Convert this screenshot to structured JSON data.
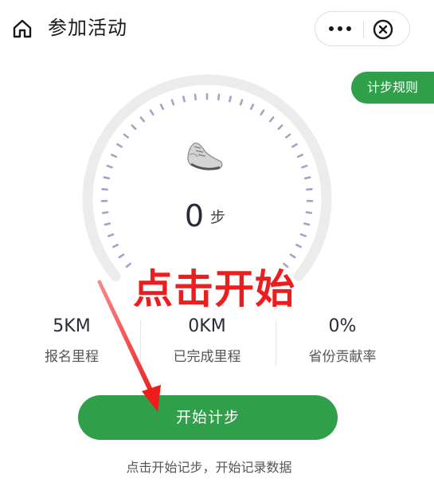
{
  "header": {
    "title": "参加活动",
    "home_icon": "home-icon",
    "more_icon": "more-dots-icon",
    "close_icon": "close-circle-icon"
  },
  "rules_label": "计步规则",
  "gauge": {
    "steps": "0",
    "unit": "步",
    "icon": "sneaker-icon"
  },
  "annotation": "点击开始",
  "stats": [
    {
      "value": "5KM",
      "label": "报名里程"
    },
    {
      "value": "0KM",
      "label": "已完成里程"
    },
    {
      "value": "0%",
      "label": "省份贡献率"
    }
  ],
  "start_button": "开始计步",
  "hint": "点击开始记步，开始记录数据",
  "colors": {
    "accent_green": "#2f9f49",
    "annotation_red": "#ee1d1d",
    "tick_purple": "#a6a2c6",
    "ring_gray": "#ececec"
  }
}
